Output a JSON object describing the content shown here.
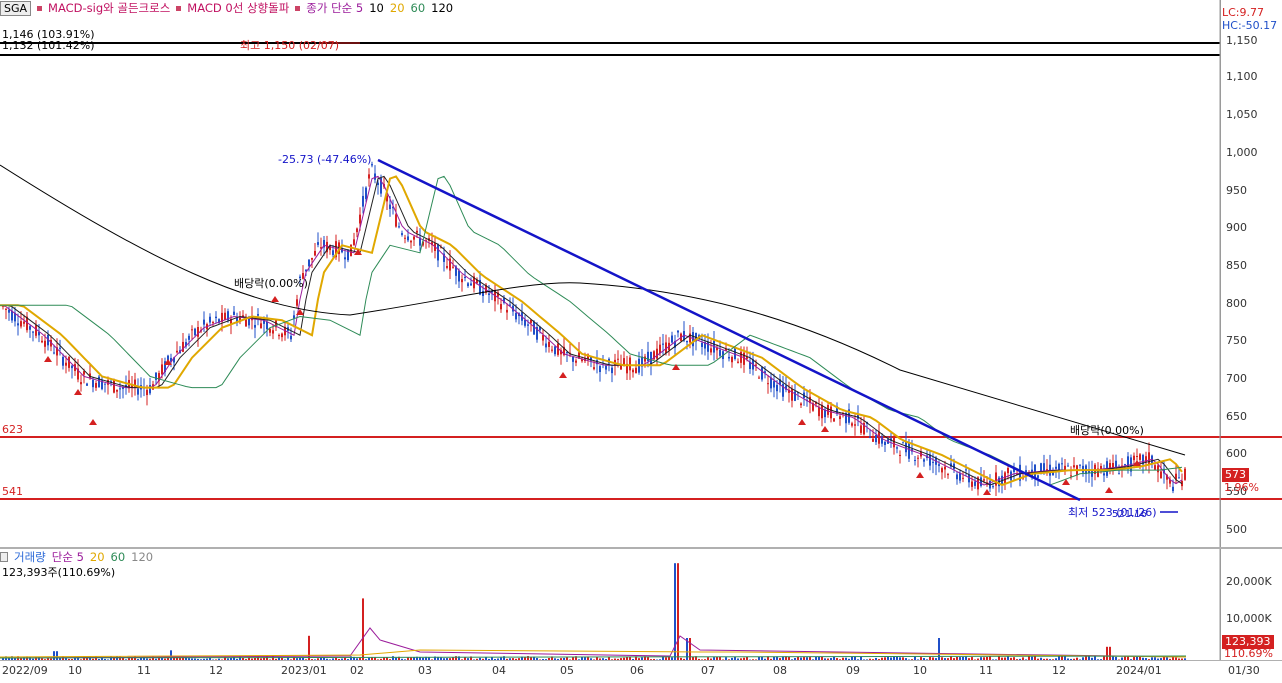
{
  "legend": {
    "symbol_chip": "SGA",
    "items": [
      "MACD-sig와 골든크로스",
      "MACD 0선 상향돌파",
      "종가 단순 5",
      "10",
      "20",
      "60",
      "120"
    ],
    "colors": {
      "ma5": "#9b1c9b",
      "ma10": "#000000",
      "ma20": "#e0a800",
      "ma60": "#2e8b57",
      "ma120": "#000000"
    }
  },
  "corner": {
    "lc": "LC:9.77",
    "hc": "HC:-50.17"
  },
  "top_lines": {
    "line1": "1,146 (103.91%)",
    "line2": "1,132 (101.42%)"
  },
  "annotations": {
    "high": "최고 1,150 (02/07)",
    "low": "최저 523 (01/26)",
    "trend_change": "-25.73 (-47.46%)",
    "ex_div_1": "배당락(0.00%)",
    "ex_div_2": "배당락(0.00%)",
    "low_value": "521.16",
    "h_line_upper": "623",
    "h_line_lower": "541"
  },
  "price_axis": {
    "ticks": [
      "1,150",
      "1,100",
      "1,050",
      "1,000",
      "950",
      "900",
      "850",
      "800",
      "750",
      "700",
      "650",
      "600",
      "550",
      "500"
    ],
    "current_price": "573",
    "current_change": "1.96%",
    "highlight_color": "#d42020"
  },
  "volume": {
    "legend_items": [
      "거래량",
      "단순 5",
      "20",
      "60",
      "120"
    ],
    "summary": "123,393주(110.69%)",
    "ticks": [
      "20,000K",
      "10,000K"
    ],
    "current_volume": "123,393",
    "current_pct": "110.69%"
  },
  "x_axis": {
    "labels": [
      "2022/09",
      "10",
      "11",
      "12",
      "2023/01",
      "02",
      "03",
      "04",
      "05",
      "06",
      "07",
      "08",
      "09",
      "10",
      "11",
      "12",
      "2024/01",
      "01/30"
    ]
  },
  "colors": {
    "up": "#d42020",
    "down": "#1f4fc8",
    "trend": "#1414c8",
    "hline": "#d42020"
  }
}
